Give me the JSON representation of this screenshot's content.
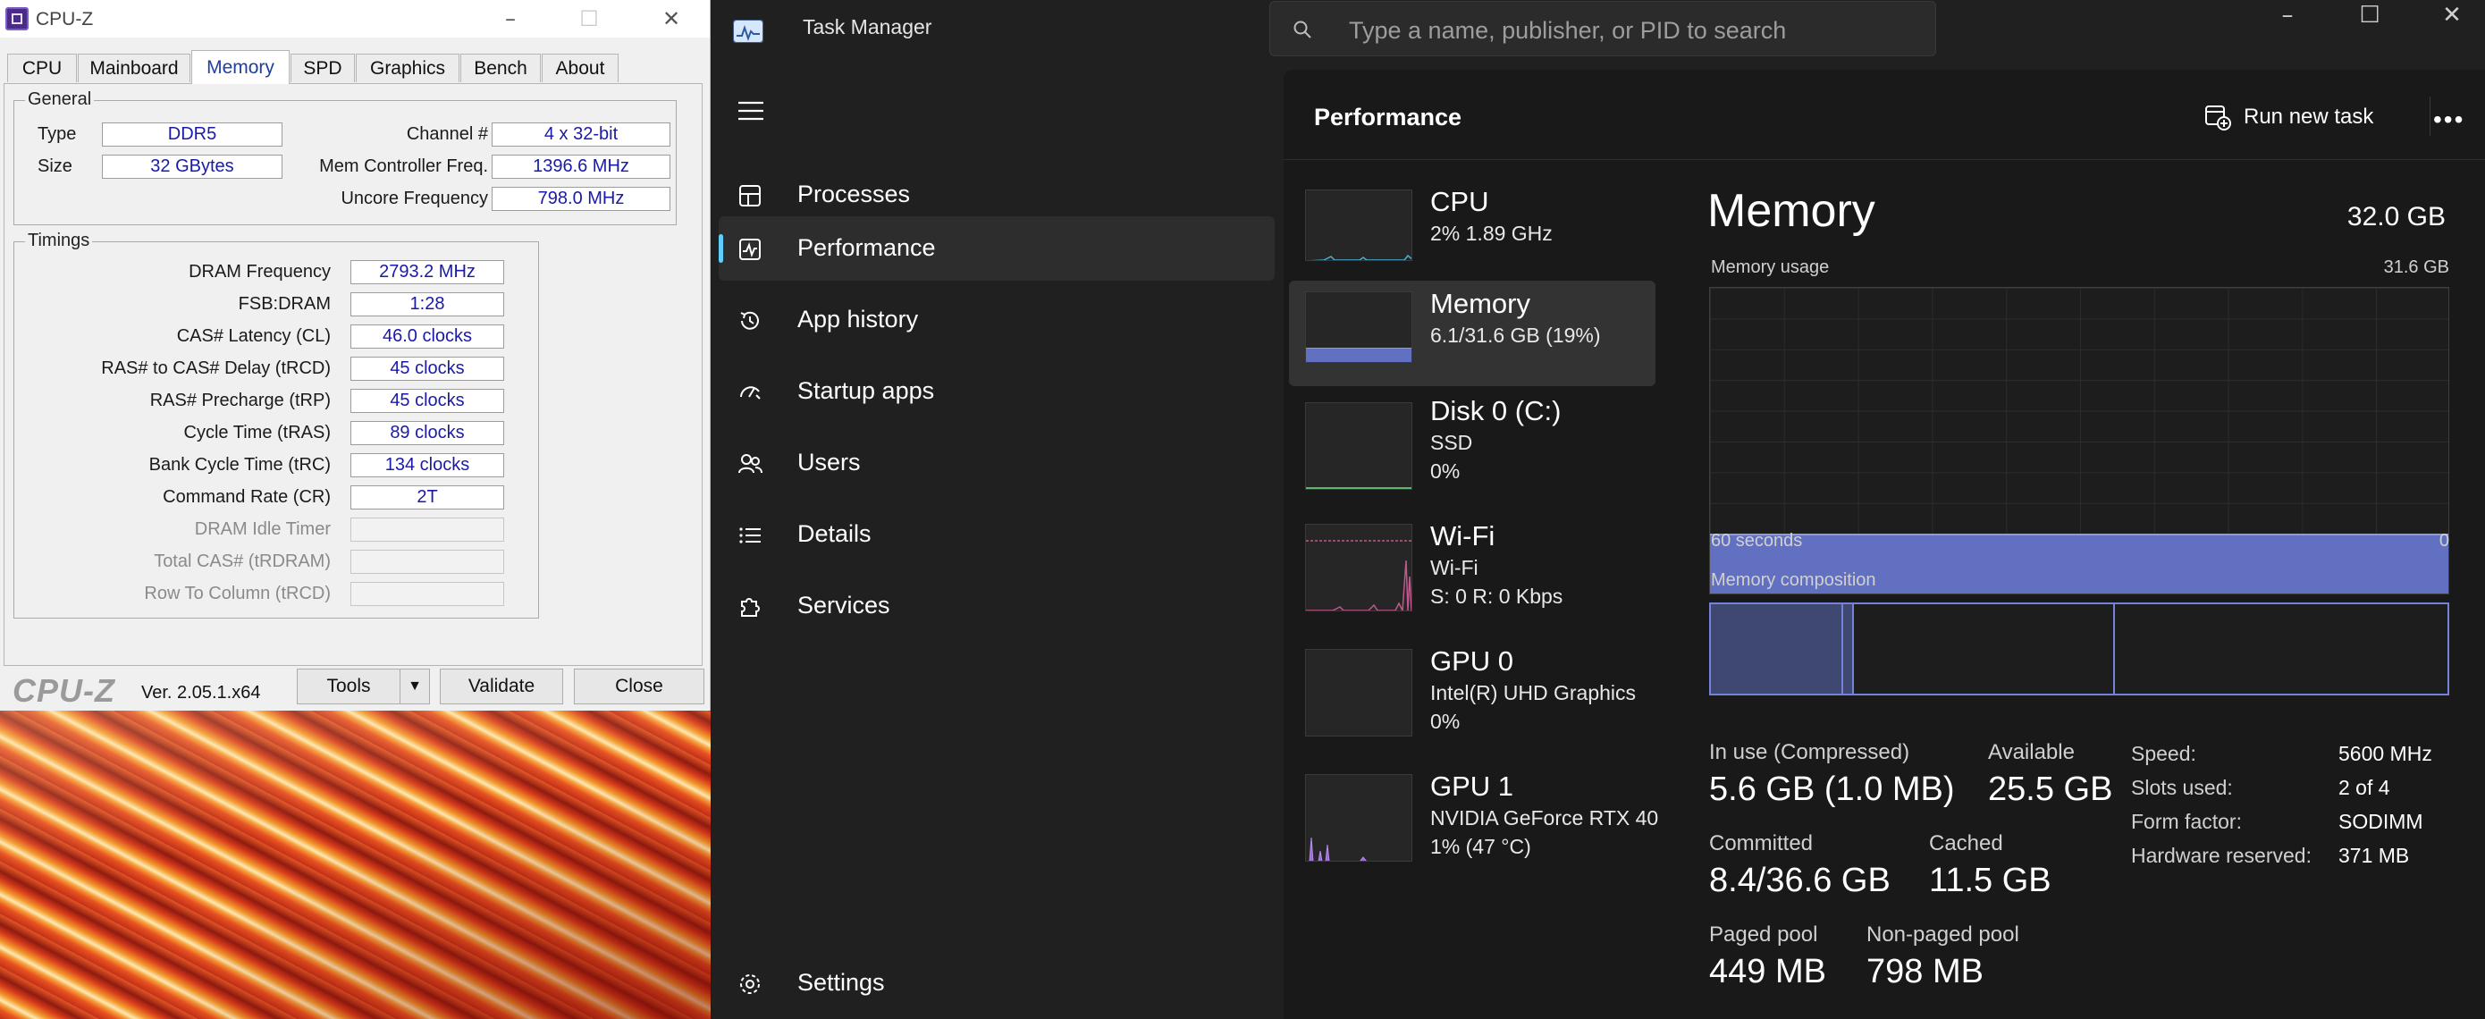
{
  "cpuz": {
    "title": "CPU-Z",
    "tabs": [
      "CPU",
      "Mainboard",
      "Memory",
      "SPD",
      "Graphics",
      "Bench",
      "About"
    ],
    "active_tab": "Memory",
    "general": {
      "title": "General",
      "type_label": "Type",
      "type_value": "DDR5",
      "size_label": "Size",
      "size_value": "32 GBytes",
      "channel_label": "Channel #",
      "channel_value": "4 x 32-bit",
      "mem_ctrl_label": "Mem Controller Freq.",
      "mem_ctrl_value": "1396.6 MHz",
      "uncore_label": "Uncore Frequency",
      "uncore_value": "798.0 MHz"
    },
    "timings": {
      "title": "Timings",
      "rows": [
        {
          "label": "DRAM Frequency",
          "value": "2793.2 MHz"
        },
        {
          "label": "FSB:DRAM",
          "value": "1:28"
        },
        {
          "label": "CAS# Latency (CL)",
          "value": "46.0 clocks"
        },
        {
          "label": "RAS# to CAS# Delay (tRCD)",
          "value": "45 clocks"
        },
        {
          "label": "RAS# Precharge (tRP)",
          "value": "45 clocks"
        },
        {
          "label": "Cycle Time (tRAS)",
          "value": "89 clocks"
        },
        {
          "label": "Bank Cycle Time (tRC)",
          "value": "134 clocks"
        },
        {
          "label": "Command Rate (CR)",
          "value": "2T"
        },
        {
          "label": "DRAM Idle Timer",
          "value": ""
        },
        {
          "label": "Total CAS# (tRDRAM)",
          "value": ""
        },
        {
          "label": "Row To Column (tRCD)",
          "value": ""
        }
      ]
    },
    "footer": {
      "logo": "CPU-Z",
      "version": "Ver. 2.05.1.x64",
      "tools_label": "Tools",
      "validate_label": "Validate",
      "close_label": "Close"
    }
  },
  "taskmanager": {
    "title": "Task Manager",
    "search_placeholder": "Type a name, publisher, or PID to search",
    "nav": [
      {
        "label": "Processes"
      },
      {
        "label": "Performance"
      },
      {
        "label": "App history"
      },
      {
        "label": "Startup apps"
      },
      {
        "label": "Users"
      },
      {
        "label": "Details"
      },
      {
        "label": "Services"
      }
    ],
    "nav_active": "Performance",
    "settings_label": "Settings",
    "page_title": "Performance",
    "run_new_task_label": "Run new task",
    "more_label": "•••",
    "devices": [
      {
        "name": "CPU",
        "sub1": "2%  1.89 GHz",
        "sub2": ""
      },
      {
        "name": "Memory",
        "sub1": "6.1/31.6 GB (19%)",
        "sub2": ""
      },
      {
        "name": "Disk 0 (C:)",
        "sub1": "SSD",
        "sub2": "0%"
      },
      {
        "name": "Wi-Fi",
        "sub1": "Wi-Fi",
        "sub2": "S: 0  R: 0 Kbps"
      },
      {
        "name": "GPU 0",
        "sub1": "Intel(R) UHD Graphics",
        "sub2": "0%"
      },
      {
        "name": "GPU 1",
        "sub1": "NVIDIA GeForce RTX 40",
        "sub2": "1%  (47 °C)"
      }
    ],
    "memory": {
      "title": "Memory",
      "total": "32.0 GB",
      "usage_label": "Memory usage",
      "usage_max": "31.6 GB",
      "usage_fraction": 0.19,
      "time_left": "60 seconds",
      "time_right": "0",
      "composition_label": "Memory composition",
      "in_use_label": "In use (Compressed)",
      "in_use_value": "5.6 GB (1.0 MB)",
      "available_label": "Available",
      "available_value": "25.5 GB",
      "committed_label": "Committed",
      "committed_value": "8.4/36.6 GB",
      "cached_label": "Cached",
      "cached_value": "11.5 GB",
      "paged_label": "Paged pool",
      "paged_value": "449 MB",
      "nonpaged_label": "Non-paged pool",
      "nonpaged_value": "798 MB",
      "specs": [
        {
          "label": "Speed:",
          "value": "5600 MHz"
        },
        {
          "label": "Slots used:",
          "value": "2 of 4"
        },
        {
          "label": "Form factor:",
          "value": "SODIMM"
        },
        {
          "label": "Hardware reserved:",
          "value": "371 MB"
        }
      ]
    },
    "accent_color": "#60cdff",
    "memory_color": "#6170c0"
  }
}
